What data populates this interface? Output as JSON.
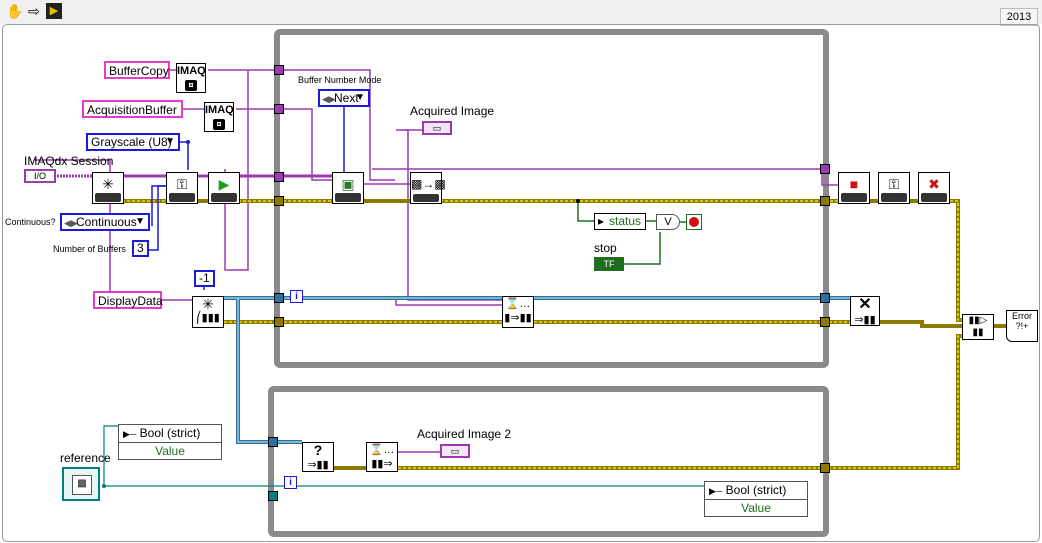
{
  "toolbar": {
    "icons": [
      "hand-icon",
      "arrow-icon",
      "run-vi-icon"
    ],
    "year": "2013"
  },
  "labels": {
    "imaqdx_session": "IMAQdx Session",
    "continuous": "Continuous?",
    "number_of_buffers": "Number of Buffers",
    "buffer_number_mode": "Buffer Number Mode",
    "acquired_image": "Acquired Image",
    "acquired_image_2": "Acquired Image 2",
    "stop": "stop",
    "reference": "reference"
  },
  "constants": {
    "buffer_copy": "BufferCopy",
    "acquisition_buffer": "AcquisitionBuffer",
    "display_data": "DisplayData",
    "image_type": "Grayscale (U8)",
    "acquisition_mode": "Continuous",
    "num_buffers": "3",
    "buffer_mode": "Next",
    "minus_one": "-1",
    "session_io": "I/O",
    "imaq_text": "IMAQ",
    "iteration_i": "i",
    "status": "status",
    "tf": "TF",
    "or_gate": "V",
    "error_glyph": "Error ?!+"
  },
  "property_nodes": [
    {
      "header": "Bool (strict)",
      "value": "Value"
    },
    {
      "header": "Bool (strict)",
      "value": "Value"
    }
  ],
  "colors": {
    "image_wire": "#9c3ab0",
    "error_wire": "#c8b400",
    "queue_wire": "#2e6f9f",
    "bool_wire": "#1f6e1f",
    "int_wire": "#1b1bd6",
    "refnum_wire": "#008080",
    "loop_frame": "#8a8a8a"
  }
}
